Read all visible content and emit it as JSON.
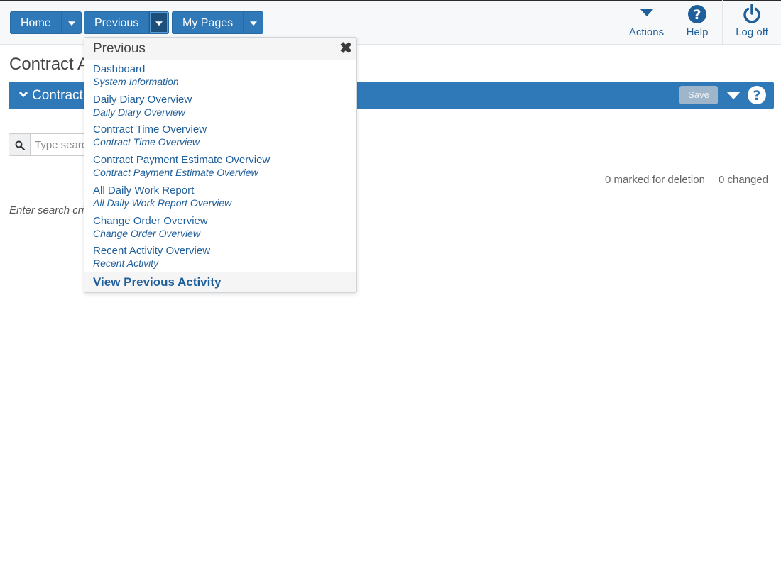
{
  "nav": {
    "home_label": "Home",
    "previous_label": "Previous",
    "mypages_label": "My Pages"
  },
  "toolbar": {
    "actions_label": "Actions",
    "help_label": "Help",
    "logoff_label": "Log off"
  },
  "page": {
    "title": "Contract A"
  },
  "panel": {
    "title": "Contract",
    "save_label": "Save"
  },
  "search": {
    "placeholder": "Type search"
  },
  "status": {
    "marked_for_deletion": "0 marked for deletion",
    "changed": "0 changed"
  },
  "hint": "Enter search cri",
  "dropdown": {
    "title": "Previous",
    "items": [
      {
        "label": "Dashboard",
        "sub": "System Information"
      },
      {
        "label": "Daily Diary Overview",
        "sub": "Daily Diary Overview"
      },
      {
        "label": "Contract Time Overview",
        "sub": "Contract Time Overview"
      },
      {
        "label": "Contract Payment Estimate Overview",
        "sub": "Contract Payment Estimate Overview"
      },
      {
        "label": "All Daily Work Report",
        "sub": "All Daily Work Report Overview"
      },
      {
        "label": "Change Order Overview",
        "sub": "Change Order Overview"
      },
      {
        "label": "Recent Activity Overview",
        "sub": "Recent Activity"
      }
    ],
    "footer_label": "View Previous Activity"
  },
  "colors": {
    "primary": "#2f79b9",
    "link": "#1f5f9b",
    "active_caret": "#1c4f7c"
  }
}
